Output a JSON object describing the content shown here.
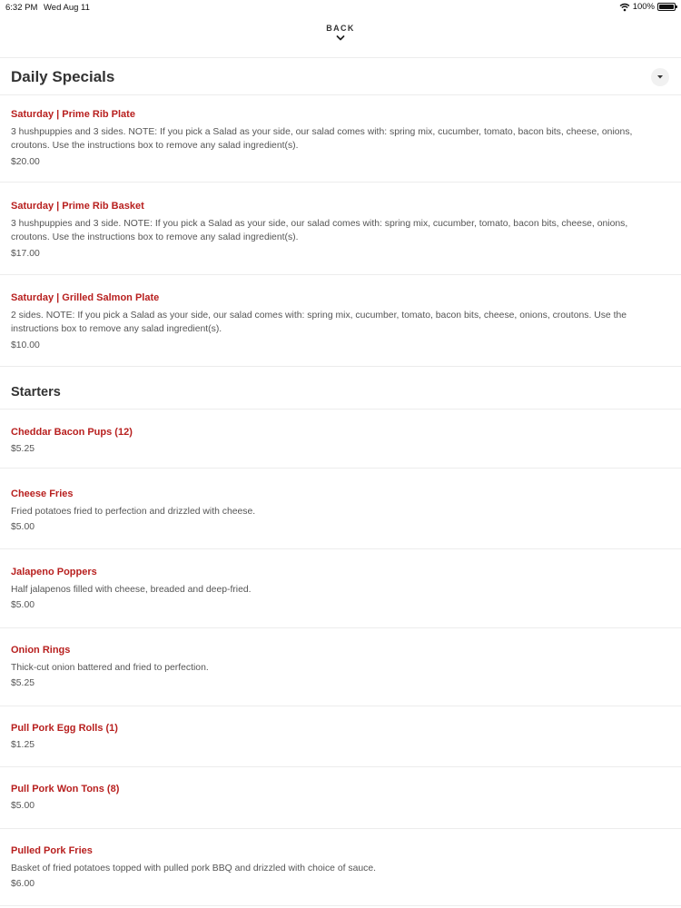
{
  "status_bar": {
    "time": "6:32 PM",
    "date": "Wed Aug 11",
    "battery": "100%",
    "icons": [
      "wifi-icon",
      "battery-icon"
    ]
  },
  "nav": {
    "back_label": "BACK",
    "back_icon": "chevron-down-icon"
  },
  "sections": {
    "daily_specials": {
      "title": "Daily Specials",
      "toggle_icon": "chevron-down-icon",
      "items": [
        {
          "name": "Saturday | Prime Rib Plate",
          "description": "3 hushpuppies and 3 sides. NOTE: If you pick a Salad as your side, our salad comes with: spring mix, cucumber, tomato, bacon bits, cheese, onions, croutons. Use the instructions box to remove any salad ingredient(s).",
          "price": "$20.00"
        },
        {
          "name": "Saturday | Prime Rib Basket",
          "description": "3 hushpuppies and 3 side. NOTE: If you pick a Salad as your side, our salad comes with: spring mix, cucumber, tomato, bacon bits, cheese, onions, croutons. Use the instructions box to remove any salad ingredient(s).",
          "price": "$17.00"
        },
        {
          "name": "Saturday | Grilled Salmon Plate",
          "description": "2 sides. NOTE: If you pick a Salad as your side, our salad comes with: spring mix, cucumber, tomato, bacon bits, cheese, onions, croutons. Use the instructions box to remove any salad ingredient(s).",
          "price": "$10.00"
        }
      ]
    },
    "starters": {
      "title": "Starters",
      "items": [
        {
          "name": "Cheddar Bacon Pups (12)",
          "description": "",
          "price": "$5.25"
        },
        {
          "name": "Cheese Fries",
          "description": "Fried potatoes fried to perfection and drizzled with cheese.",
          "price": "$5.00"
        },
        {
          "name": "Jalapeno Poppers",
          "description": "Half jalapenos filled with cheese, breaded and deep-fried.",
          "price": "$5.00"
        },
        {
          "name": "Onion Rings",
          "description": "Thick-cut onion battered and fried to perfection.",
          "price": "$5.25"
        },
        {
          "name": "Pull Pork Egg Rolls (1)",
          "description": "",
          "price": "$1.25"
        },
        {
          "name": "Pull Pork Won Tons (8)",
          "description": "",
          "price": "$5.00"
        },
        {
          "name": "Pulled Pork Fries",
          "description": "Basket of fried potatoes topped with pulled pork BBQ and drizzled with choice of sauce.",
          "price": "$6.00"
        }
      ]
    }
  },
  "colors": {
    "item_name": "#b8201f",
    "text": "#555555",
    "divider": "#ececec"
  }
}
